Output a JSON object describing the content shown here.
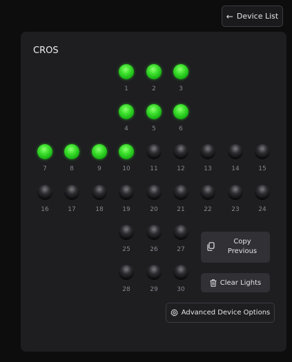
{
  "header": {
    "back_label": "Device List",
    "back_icon": "arrow-left-icon"
  },
  "device": {
    "name": "CROS"
  },
  "lights": [
    {
      "number": "1",
      "on": true
    },
    {
      "number": "2",
      "on": true
    },
    {
      "number": "3",
      "on": true
    },
    {
      "number": "4",
      "on": true
    },
    {
      "number": "5",
      "on": true
    },
    {
      "number": "6",
      "on": true
    },
    {
      "number": "7",
      "on": true
    },
    {
      "number": "8",
      "on": true
    },
    {
      "number": "9",
      "on": true
    },
    {
      "number": "10",
      "on": true
    },
    {
      "number": "11",
      "on": false
    },
    {
      "number": "12",
      "on": false
    },
    {
      "number": "13",
      "on": false
    },
    {
      "number": "14",
      "on": false
    },
    {
      "number": "15",
      "on": false
    },
    {
      "number": "16",
      "on": false
    },
    {
      "number": "17",
      "on": false
    },
    {
      "number": "18",
      "on": false
    },
    {
      "number": "19",
      "on": false
    },
    {
      "number": "20",
      "on": false
    },
    {
      "number": "21",
      "on": false
    },
    {
      "number": "22",
      "on": false
    },
    {
      "number": "23",
      "on": false
    },
    {
      "number": "24",
      "on": false
    },
    {
      "number": "25",
      "on": false
    },
    {
      "number": "26",
      "on": false
    },
    {
      "number": "27",
      "on": false
    },
    {
      "number": "28",
      "on": false
    },
    {
      "number": "29",
      "on": false
    },
    {
      "number": "30",
      "on": false
    }
  ],
  "actions": {
    "copy_previous_label": "Copy Previous",
    "copy_icon": "copy-icon",
    "clear_lights_label": "Clear Lights",
    "clear_icon": "trash-icon",
    "advanced_label": "Advanced Device Options",
    "advanced_icon": "gear-icon"
  },
  "colors": {
    "light_on": "#3ee02e",
    "light_off": "#1a1a1c",
    "panel": "#1e1e21",
    "background": "#0d0d0e"
  }
}
